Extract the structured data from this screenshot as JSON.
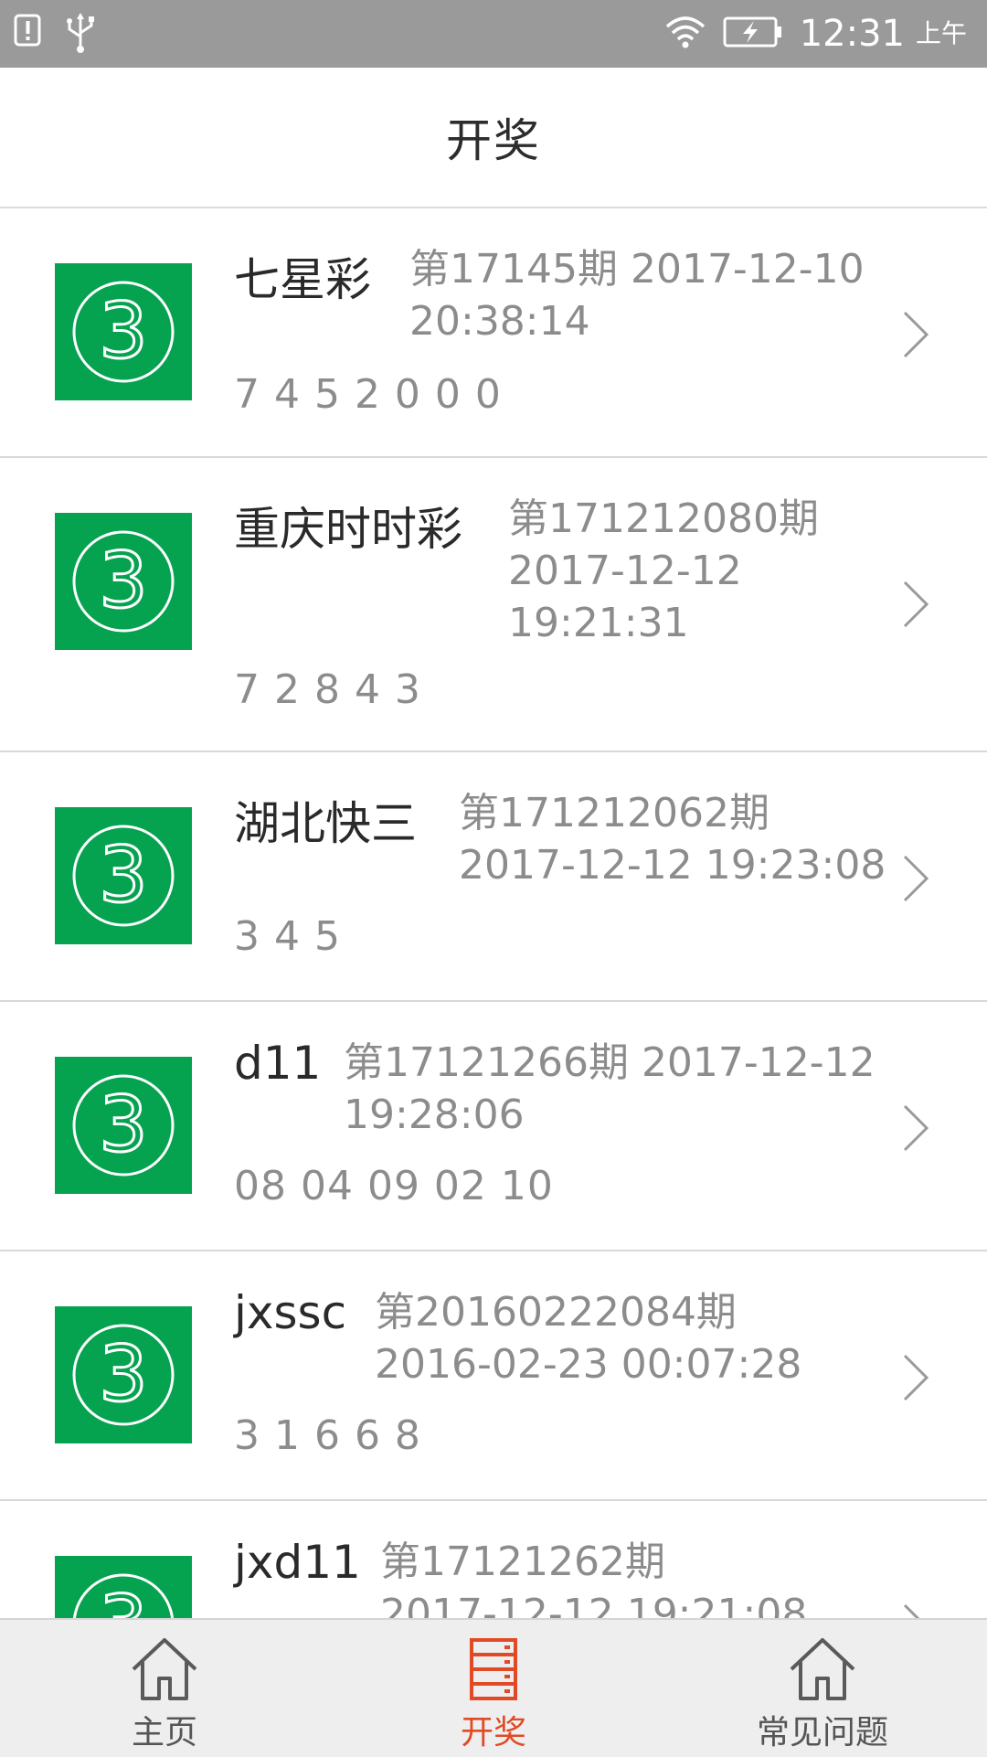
{
  "status_bar": {
    "time": "12:31",
    "ampm": "上午"
  },
  "header": {
    "title": "开奖"
  },
  "list": [
    {
      "name": "七星彩",
      "issue_line1": "第17145期 2017-12-10",
      "issue_line2": "20:38:14",
      "issue_line3": "",
      "numbers": "7 4 5 2 0 0 0"
    },
    {
      "name": "重庆时时彩",
      "issue_line1": "第171212080期",
      "issue_line2": "2017-12-12",
      "issue_line3": "19:21:31",
      "numbers": "7 2 8 4 3"
    },
    {
      "name": "湖北快三",
      "issue_line1": "第171212062期",
      "issue_line2": "2017-12-12 19:23:08",
      "issue_line3": "",
      "numbers": "3 4 5"
    },
    {
      "name": "d11",
      "issue_line1": "第17121266期 2017-12-12",
      "issue_line2": "19:28:06",
      "issue_line3": "",
      "numbers": "08 04 09 02 10"
    },
    {
      "name": "jxssc",
      "issue_line1": "第20160222084期",
      "issue_line2": "2016-02-23 00:07:28",
      "issue_line3": "",
      "numbers": "3 1 6 6 8"
    },
    {
      "name": "jxd11",
      "issue_line1": "第17121262期",
      "issue_line2": "2017-12-12 19:21:08",
      "issue_line3": "",
      "numbers": ""
    }
  ],
  "bottom_nav": {
    "home_label": "主页",
    "lottery_label": "开奖",
    "faq_label": "常见问题"
  },
  "colors": {
    "brand_green": "#05a24f",
    "active_tab": "#e04a25",
    "status_bar": "#9a9a9a"
  }
}
